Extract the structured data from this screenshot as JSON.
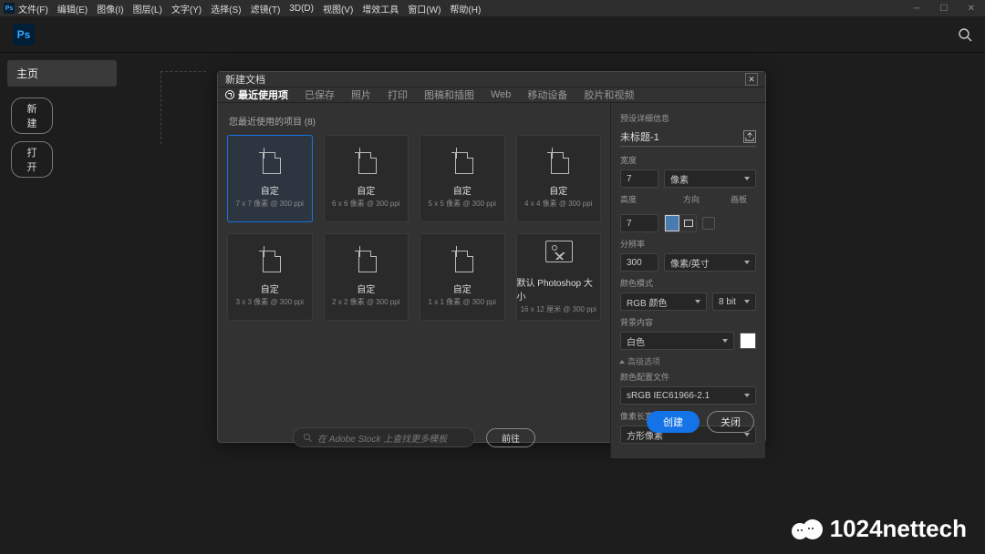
{
  "menubar": {
    "items": [
      "文件(F)",
      "编辑(E)",
      "图像(I)",
      "图层(L)",
      "文字(Y)",
      "选择(S)",
      "滤镜(T)",
      "3D(D)",
      "视图(V)",
      "增效工具",
      "窗口(W)",
      "帮助(H)"
    ]
  },
  "logo": "Ps",
  "sidebar": {
    "home": "主页",
    "new_btn": "新建",
    "open_btn": "打开"
  },
  "modal": {
    "title": "新建文档",
    "tabs": [
      "最近使用项",
      "已保存",
      "照片",
      "打印",
      "图稿和插图",
      "Web",
      "移动设备",
      "胶片和视频"
    ],
    "recent_label": "您最近使用的项目 (8)",
    "cards": [
      {
        "title": "自定",
        "sub": "7 x 7 像素 @ 300 ppi"
      },
      {
        "title": "自定",
        "sub": "6 x 6 像素 @ 300 ppi"
      },
      {
        "title": "自定",
        "sub": "5 x 5 像素 @ 300 ppi"
      },
      {
        "title": "自定",
        "sub": "4 x 4 像素 @ 300 ppi"
      },
      {
        "title": "自定",
        "sub": "3 x 3 像素 @ 300 ppi"
      },
      {
        "title": "自定",
        "sub": "2 x 2 像素 @ 300 ppi"
      },
      {
        "title": "自定",
        "sub": "1 x 1 像素 @ 300 ppi"
      },
      {
        "title": "默认 Photoshop 大小",
        "sub": "16 x 12 厘米 @ 300 ppi"
      }
    ],
    "stock_placeholder": "在 Adobe Stock 上查找更多模板",
    "stock_go": "前往",
    "create": "创建",
    "close_btn": "关闭"
  },
  "details": {
    "presets_label": "预设详细信息",
    "name": "未标题-1",
    "width_label": "宽度",
    "width_val": "7",
    "width_unit": "像素",
    "height_label": "高度",
    "height_val": "7",
    "orient_label": "方向",
    "artboard_label": "画板",
    "res_label": "分辨率",
    "res_val": "300",
    "res_unit": "像素/英寸",
    "color_label": "颜色模式",
    "color_mode": "RGB 颜色",
    "color_depth": "8 bit",
    "bg_label": "背景内容",
    "bg_val": "白色",
    "advanced": "高级选项",
    "profile_label": "颜色配置文件",
    "profile_val": "sRGB IEC61966-2.1",
    "aspect_label": "像素长宽比",
    "aspect_val": "方形像素"
  },
  "watermark": "1024nettech"
}
